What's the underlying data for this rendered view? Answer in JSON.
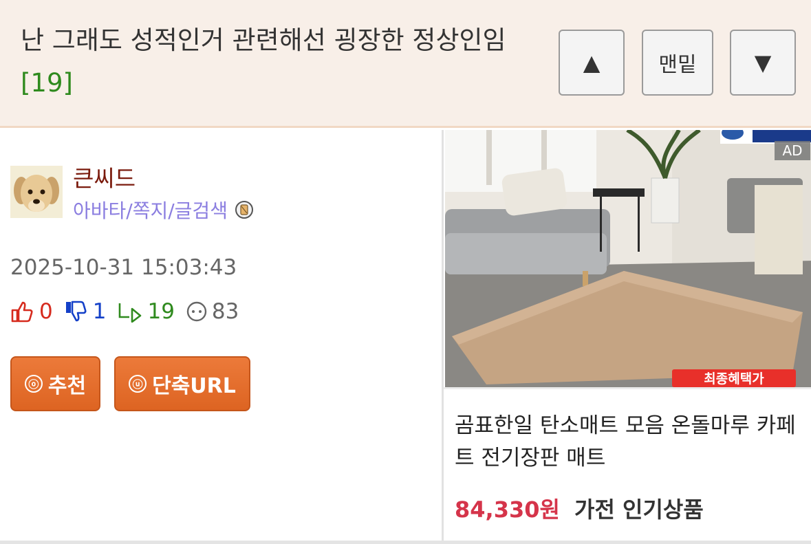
{
  "header": {
    "title": "난 그래도 성적인거 관련해선 굉장한 정상인임",
    "comment_count": "[19]",
    "up_label": "▲",
    "bottom_label": "맨밑",
    "down_label": "▼"
  },
  "post": {
    "username": "큰씨드",
    "user_links": "아바타/쪽지/글검색",
    "datetime": "2025-10-31 15:03:43",
    "stats": {
      "likes": "0",
      "dislikes": "1",
      "replies": "19",
      "views": "83"
    },
    "buttons": {
      "recommend_icon": "ⓞ",
      "recommend": "추천",
      "shorturl_icon": "ⓤ",
      "shorturl": "단축URL"
    }
  },
  "ad": {
    "label": "AD",
    "banner_text": "최종혜택가",
    "title": "곰표한일 탄소매트 모음 온돌마루 카페트 전기장판 매트",
    "price": "84,330원",
    "category": "가전 인기상품"
  },
  "colors": {
    "header_bg": "#f8efe8",
    "accent_orange": "#e06a28",
    "username": "#7a1a0c",
    "link_purple": "#8b7ee0",
    "price_red": "#d5344a",
    "count_green": "#2f8a1e"
  },
  "icons": [
    "thumbs-up-icon",
    "thumbs-down-icon",
    "reply-icon",
    "view-icon",
    "user-badge-icon"
  ]
}
